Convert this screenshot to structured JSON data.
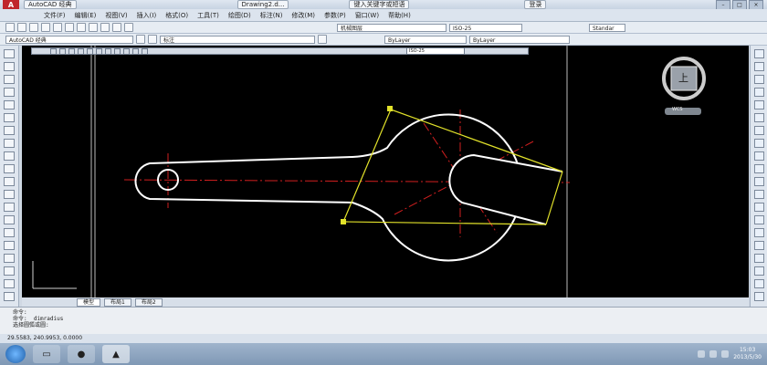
{
  "window": {
    "title": "AutoCAD 经典",
    "document": "Drawing2.d...",
    "search_placeholder": "键入关键字或短语",
    "login_label": "登录"
  },
  "menu": {
    "items": [
      "文件(F)",
      "编辑(E)",
      "视图(V)",
      "插入(I)",
      "格式(O)",
      "工具(T)",
      "绘图(D)",
      "标注(N)",
      "修改(M)",
      "参数(P)",
      "窗口(W)",
      "帮助(H)"
    ]
  },
  "toolbar": {
    "workspace": "AutoCAD 经典",
    "layer": "标注",
    "text_style": "机械图层",
    "dim_style": "ISO-25",
    "dim_style_2": "ISO-25",
    "color": "ByLayer",
    "linetype": "ByLayer",
    "standard": "Standar"
  },
  "viewcube": {
    "face": "上",
    "wcs": "WCS"
  },
  "tabs": [
    "模型",
    "布局1",
    "布局2"
  ],
  "command": {
    "lines": [
      "命令:",
      "命令: _dimradius"
    ],
    "prompt": "选择圆弧或圆:"
  },
  "status": {
    "coords": "29.5583, 240.9953, 0.0000"
  },
  "taskbar": {
    "time": "15:03",
    "date": "2013/5/30"
  },
  "colors": {
    "canvas": "#000000",
    "object_line": "#ffffff",
    "center_line": "#d11f1f",
    "dimension_line": "#e2e22a"
  }
}
